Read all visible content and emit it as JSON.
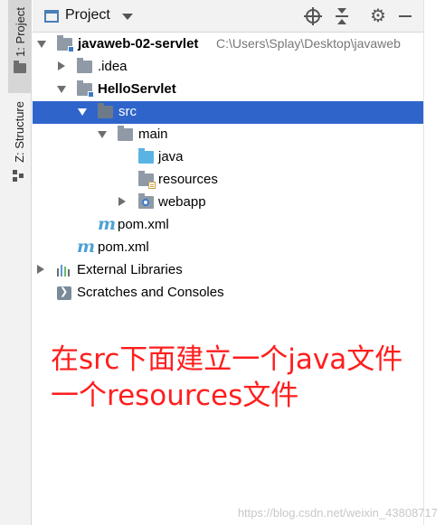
{
  "sidebar": {
    "project_tab_label": "1: Project",
    "structure_tab_label": "Z: Structure"
  },
  "header": {
    "title": "Project"
  },
  "tree": {
    "root": {
      "label": "javaweb-02-servlet",
      "path": "C:\\Users\\Splay\\Desktop\\javaweb"
    },
    "idea": {
      "label": ".idea"
    },
    "module": {
      "label": "HelloServlet"
    },
    "src": {
      "label": "src"
    },
    "main": {
      "label": "main"
    },
    "java": {
      "label": "java"
    },
    "resources": {
      "label": "resources"
    },
    "webapp": {
      "label": "webapp"
    },
    "module_pom": {
      "label": "pom.xml"
    },
    "root_pom": {
      "label": "pom.xml"
    },
    "external_libraries": {
      "label": "External Libraries"
    },
    "scratches": {
      "label": "Scratches and Consoles"
    }
  },
  "annotation": {
    "line1": "在src下面建立一个java文件",
    "line2": "一个resources文件"
  },
  "watermark": "https://blog.csdn.net/weixin_43808717",
  "colors": {
    "selection": "#2f65ca",
    "annotation": "#ff1e1e",
    "maven_icon": "#4ea1d3",
    "source_folder": "#5ab4e3"
  },
  "icons": {
    "header": [
      "project-icon",
      "locate-icon",
      "collapse-all-icon",
      "settings-gear-icon",
      "hide-icon"
    ]
  }
}
